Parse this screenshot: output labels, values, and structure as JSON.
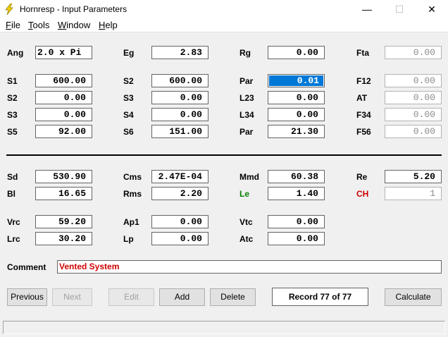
{
  "window": {
    "title": "Hornresp - Input Parameters",
    "min_glyph": "—",
    "max_glyph": "☐",
    "close_glyph": "✕"
  },
  "menu": {
    "file": "File",
    "tools": "Tools",
    "window": "Window",
    "help": "Help"
  },
  "params": {
    "ang": {
      "label": "Ang",
      "value": "2.0 x Pi"
    },
    "eg": {
      "label": "Eg",
      "value": "2.83"
    },
    "rg": {
      "label": "Rg",
      "value": "0.00"
    },
    "fta": {
      "label": "Fta",
      "value": "0.00"
    },
    "s1": {
      "label": "S1",
      "value": "600.00"
    },
    "s2b": {
      "label": "S2",
      "value": "600.00"
    },
    "par1": {
      "label": "Par",
      "value": "0.01"
    },
    "f12": {
      "label": "F12",
      "value": "0.00"
    },
    "s2": {
      "label": "S2",
      "value": "0.00"
    },
    "s3b": {
      "label": "S3",
      "value": "0.00"
    },
    "l23": {
      "label": "L23",
      "value": "0.00"
    },
    "at": {
      "label": "AT",
      "value": "0.00"
    },
    "s3": {
      "label": "S3",
      "value": "0.00"
    },
    "s4": {
      "label": "S4",
      "value": "0.00"
    },
    "l34": {
      "label": "L34",
      "value": "0.00"
    },
    "f34": {
      "label": "F34",
      "value": "0.00"
    },
    "s5": {
      "label": "S5",
      "value": "92.00"
    },
    "s6": {
      "label": "S6",
      "value": "151.00"
    },
    "par2": {
      "label": "Par",
      "value": "21.30"
    },
    "f56": {
      "label": "F56",
      "value": "0.00"
    },
    "sd": {
      "label": "Sd",
      "value": "530.90"
    },
    "cms": {
      "label": "Cms",
      "value": "2.47E-04"
    },
    "mmd": {
      "label": "Mmd",
      "value": "60.38"
    },
    "re": {
      "label": "Re",
      "value": "5.20"
    },
    "bl": {
      "label": "Bl",
      "value": "16.65"
    },
    "rms": {
      "label": "Rms",
      "value": "2.20"
    },
    "le": {
      "label": "Le",
      "value": "1.40"
    },
    "ch": {
      "label": "CH",
      "value": "1"
    },
    "vrc": {
      "label": "Vrc",
      "value": "59.20"
    },
    "ap1": {
      "label": "Ap1",
      "value": "0.00"
    },
    "vtc": {
      "label": "Vtc",
      "value": "0.00"
    },
    "lrc": {
      "label": "Lrc",
      "value": "30.20"
    },
    "lp": {
      "label": "Lp",
      "value": "0.00"
    },
    "atc": {
      "label": "Atc",
      "value": "0.00"
    }
  },
  "comment": {
    "label": "Comment",
    "value": "Vented System"
  },
  "buttons": {
    "previous": "Previous",
    "next": "Next",
    "edit": "Edit",
    "add": "Add",
    "delete": "Delete",
    "record": "Record 77 of 77",
    "calculate": "Calculate"
  },
  "colors": {
    "le_label": "#008000",
    "ch_label": "#d00000",
    "comment_text": "#d00000",
    "selection": "#0078d7"
  }
}
